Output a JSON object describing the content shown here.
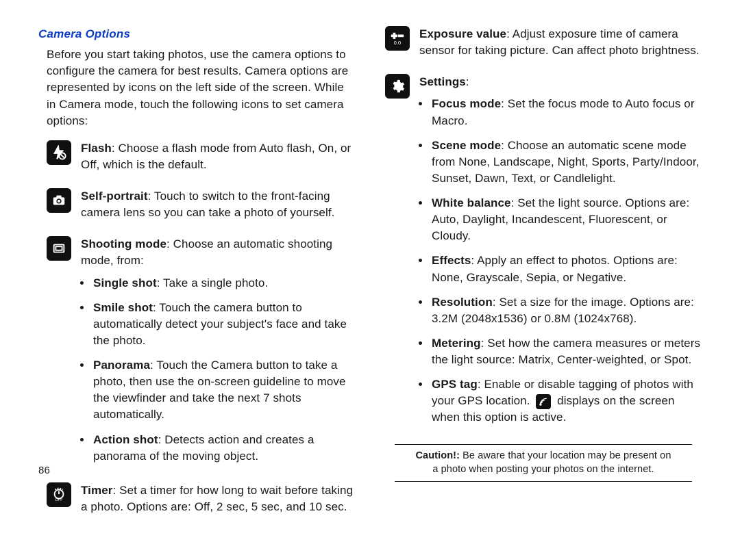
{
  "page_number": "86",
  "heading": "Camera Options",
  "intro": "Before you start taking photos, use the camera options to configure the camera for best results. Camera options are represented by icons on the left side of the screen. While in Camera mode, touch the following icons to set camera options:",
  "flash": {
    "label": "Flash",
    "text": ": Choose a flash mode from Auto flash, On, or Off, which is the default."
  },
  "self": {
    "label": "Self-portrait",
    "text": ": Touch to switch to the front-facing camera lens so you can take a photo of yourself."
  },
  "shooting": {
    "label": "Shooting mode",
    "text": ": Choose an automatic shooting mode, from:",
    "items": [
      {
        "label": "Single shot",
        "text": ": Take a single photo."
      },
      {
        "label": "Smile shot",
        "text": ": Touch the camera button to automatically detect your subject's face and take the photo."
      },
      {
        "label": "Panorama",
        "text": ": Touch the Camera button to take a photo, then use the on-screen guideline to move the viewfinder and take the next 7 shots automatically."
      },
      {
        "label": "Action shot",
        "text": ": Detects action and creates a panorama of the moving object."
      }
    ]
  },
  "timer": {
    "label": "Timer",
    "text": ": Set a timer for how long to wait before taking a photo. Options are: Off, 2 sec, 5 sec, and 10 sec."
  },
  "exposure": {
    "label": "Exposure value",
    "text": ": Adjust exposure time of camera sensor for taking picture. Can affect photo brightness."
  },
  "settings": {
    "label": "Settings",
    "colon": ":",
    "items": [
      {
        "label": "Focus mode",
        "text": ": Set the focus mode to Auto focus or Macro."
      },
      {
        "label": "Scene mode",
        "text": ": Choose an automatic scene mode from None, Landscape, Night, Sports, Party/Indoor, Sunset, Dawn, Text, or Candlelight."
      },
      {
        "label": "White balance",
        "text": ": Set the light source. Options are: Auto, Daylight, Incandescent, Fluorescent, or Cloudy."
      },
      {
        "label": "Effects",
        "text": ": Apply an effect to photos. Options are: None, Grayscale, Sepia, or Negative."
      },
      {
        "label": "Resolution",
        "text": ": Set a size for the image. Options are: 3.2M (2048x1536) or 0.8M (1024x768)."
      },
      {
        "label": "Metering",
        "text": ": Set how the camera measures or meters the light source: Matrix, Center-weighted, or Spot."
      },
      {
        "label": "GPS tag",
        "text_before": ": Enable or disable tagging of photos with your GPS location. ",
        "text_after": " displays on the screen when this option is active."
      }
    ]
  },
  "caution": {
    "label": "Caution!:",
    "text": " Be aware that your location may be present on a photo when posting your photos on the internet."
  }
}
